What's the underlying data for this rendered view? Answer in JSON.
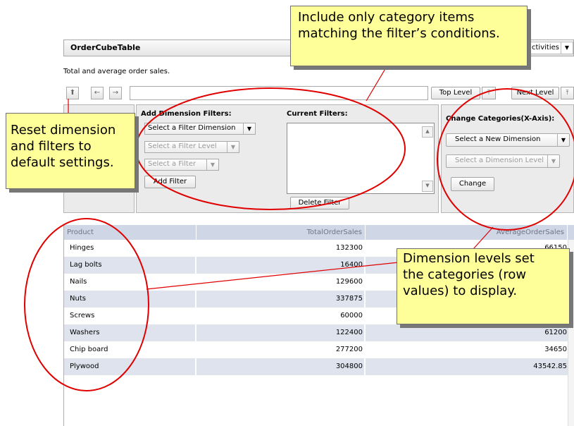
{
  "header": {
    "title": "OrderCubeTable",
    "activities_label": "ctivities"
  },
  "description": "Total and average order sales.",
  "toolbar": {
    "top_level": "Top Level",
    "next_level": "Next Level"
  },
  "filters": {
    "add_label": "Add Dimension Filters:",
    "select_dimension": "Select a Filter Dimension",
    "select_level": "Select a Filter Level",
    "select_filter": "Select a Filter",
    "add_button": "Add Filter",
    "current_label": "Current Filters:",
    "delete_button": "Delete Filter"
  },
  "categories": {
    "label": "Change Categories(X-Axis):",
    "new_dimension": "Select a New Dimension",
    "dimension_level": "Select a Dimension Level",
    "change_button": "Change"
  },
  "table": {
    "columns": [
      "Product",
      "TotalOrderSales",
      "AverageOrderSales"
    ],
    "rows": [
      [
        "Hinges",
        "132300",
        "66150"
      ],
      [
        "Lag bolts",
        "16400",
        ""
      ],
      [
        "Nails",
        "129600",
        ""
      ],
      [
        "Nuts",
        "337875",
        ""
      ],
      [
        "Screws",
        "60000",
        ""
      ],
      [
        "Washers",
        "122400",
        "61200"
      ],
      [
        "Chip board",
        "277200",
        "34650"
      ],
      [
        "Plywood",
        "304800",
        "43542.85"
      ]
    ]
  },
  "callouts": {
    "filter_items": [
      "Include only category items",
      "matching the filter’s conditions."
    ],
    "reset": [
      "Reset dimension",
      "and filters to",
      "default settings."
    ],
    "levels": [
      "Dimension levels set",
      "the categories (row",
      "values) to display."
    ]
  },
  "colors": {
    "callout_bg": "#ffff99",
    "annotation_red": "#e00000",
    "header_row": "#cfd6e6",
    "row_alt": "#dee3ee"
  }
}
